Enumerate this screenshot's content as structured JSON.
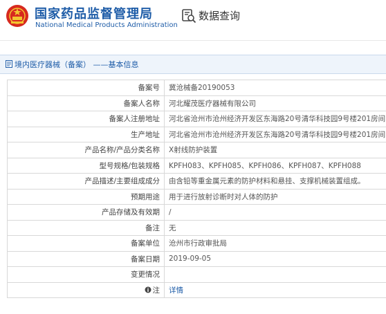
{
  "header": {
    "agency_cn": "国家药品监督管理局",
    "agency_en": "National Medical Products Administration",
    "query_title": "数据查询",
    "brand_color": "#1f5da8"
  },
  "breadcrumb": {
    "text": "境内医疗器械（备案） ——基本信息"
  },
  "record": [
    {
      "label": "备案号",
      "value": "冀沧械备20190053"
    },
    {
      "label": "备案人名称",
      "value": "河北耀茂医疗器械有限公司"
    },
    {
      "label": "备案人注册地址",
      "value": "河北省沧州市沧州经济开发区东海路20号清华科技园9号楼201房间"
    },
    {
      "label": "生产地址",
      "value": "河北省沧州市沧州经济开发区东海路20号清华科技园9号楼201房间"
    },
    {
      "label": "产品名称/产品分类名称",
      "value": "X射线防护装置"
    },
    {
      "label": "型号规格/包装规格",
      "value": "KPFH083、KPFH085、KPFH086、KPFH087、KPFH088"
    },
    {
      "label": "产品描述/主要组成成分",
      "value": "由含铅等重金属元素的防护材料和悬挂、支撑机械装置组成。"
    },
    {
      "label": "预期用途",
      "value": "用于进行放射诊断时对人体的防护"
    },
    {
      "label": "产品存储及有效期",
      "value": "/"
    },
    {
      "label": "备注",
      "value": "无"
    },
    {
      "label": "备案单位",
      "value": "沧州市行政审批局"
    },
    {
      "label": "备案日期",
      "value": "2019-09-05"
    },
    {
      "label": "变更情况",
      "value": ""
    },
    {
      "label": "注",
      "value": "详情",
      "label_icon": "info-icon",
      "value_is_link": true
    }
  ]
}
